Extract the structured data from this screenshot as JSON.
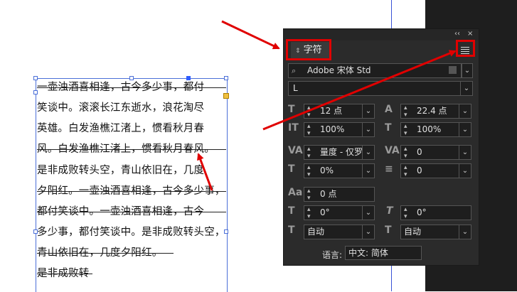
{
  "document": {
    "lines": [
      "一壶浊酒喜相逢，古今多少事，都付",
      "笑谈中。滚滚长江东逝水，浪花淘尽",
      "英雄。白发渔樵江渚上，惯看秋月春",
      "风。白发渔樵江渚上，惯看秋月春风。",
      "是非成败转头空，青山依旧在，几度",
      "夕阳红。一壶浊酒喜相逢，古今多少事，",
      "都付笑谈中。一壶浊酒喜相逢，古今",
      "多少事，都付笑谈中。是非成败转头空，",
      "青山依旧在，几度夕阳红。",
      "是非成败转"
    ]
  },
  "panel": {
    "collapse_label": "‹‹",
    "close_label": "×",
    "tab_label": "字符",
    "menu_icon": "hamburger-menu-icon",
    "font_family": "Adobe 宋体 Std",
    "font_style": "L",
    "font_size": "12 点",
    "leading": "22.4 点",
    "vertical_scale": "100%",
    "horizontal_scale": "100%",
    "kerning": "量度 - 仅罗",
    "tracking": "0",
    "tsume": "0%",
    "aki": "0",
    "baseline_shift": "0 点",
    "rotation": "0°",
    "skew": "0°",
    "aki_left": "自动",
    "aki_right": "自动",
    "language_label": "语言:",
    "language_value": "中文: 简体"
  },
  "colors": {
    "annotation": "#e00000",
    "panel_bg": "#2b2b2b",
    "selection": "#4b6fd8"
  }
}
